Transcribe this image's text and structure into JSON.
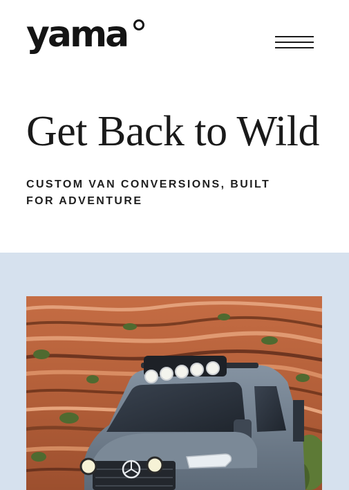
{
  "brand": {
    "name": "yama"
  },
  "header": {
    "menu_icon": "hamburger-menu-icon"
  },
  "hero": {
    "title": "Get Back to Wild",
    "subtitle": "CUSTOM VAN CONVERSIONS, BUILT FOR ADVENTURE"
  },
  "image": {
    "subject": "campervan-in-canyon",
    "colors": {
      "band": "#d6e1ee",
      "rock": "#b8643e",
      "rock_dark": "#7a3d22",
      "van": "#6f7d8c",
      "foliage": "#4f6a30"
    }
  }
}
